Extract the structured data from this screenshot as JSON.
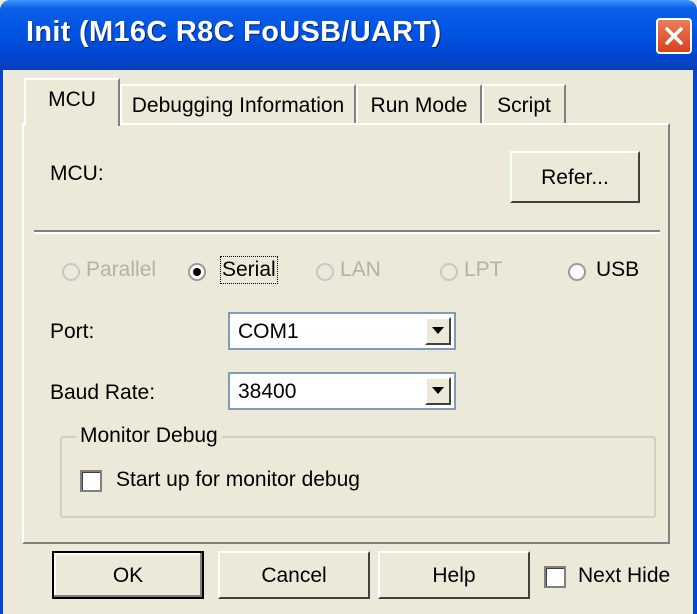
{
  "window": {
    "title": "Init (M16C R8C FoUSB/UART)"
  },
  "tabs": [
    {
      "label": "MCU",
      "active": true
    },
    {
      "label": "Debugging Information",
      "active": false
    },
    {
      "label": "Run Mode",
      "active": false
    },
    {
      "label": "Script",
      "active": false
    }
  ],
  "mcu": {
    "label": "MCU:",
    "refer_button": "Refer..."
  },
  "connection": {
    "options": [
      {
        "label": "Parallel",
        "selected": false,
        "enabled": false
      },
      {
        "label": "Serial",
        "selected": true,
        "enabled": true
      },
      {
        "label": "LAN",
        "selected": false,
        "enabled": false
      },
      {
        "label": "LPT",
        "selected": false,
        "enabled": false
      },
      {
        "label": "USB",
        "selected": false,
        "enabled": true
      }
    ]
  },
  "port": {
    "label": "Port:",
    "value": "COM1"
  },
  "baud": {
    "label": "Baud Rate:",
    "value": "38400"
  },
  "monitor": {
    "group_title": "Monitor Debug",
    "checkbox_label": "Start up for monitor debug",
    "checked": false
  },
  "footer": {
    "ok": "OK",
    "cancel": "Cancel",
    "help": "Help",
    "next_hide": "Next Hide",
    "next_hide_checked": false
  },
  "colors": {
    "title_bar": "#0054e3",
    "close_button": "#d8411b",
    "dialog_face": "#ece9d8"
  },
  "icons": {
    "close": "close-icon",
    "dropdown": "chevron-down-icon"
  }
}
